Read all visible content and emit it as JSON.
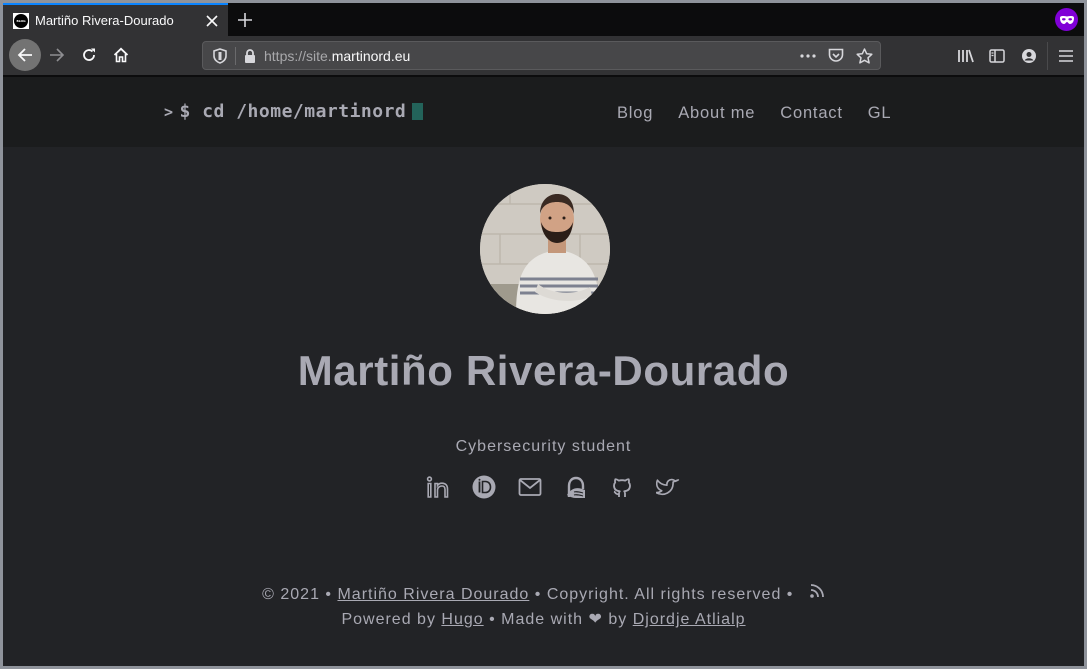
{
  "browser": {
    "tab": {
      "title": "Martiño Rivera-Dourado",
      "favicon_label": "BLOG"
    },
    "url": {
      "scheme_prefix": "https://site.",
      "host": "martinord.eu"
    },
    "icons": {
      "back": "arrow-left-icon",
      "forward": "arrow-right-icon",
      "reload": "reload-icon",
      "home": "home-icon",
      "shield": "tracking-shield-icon",
      "lock": "lock-icon",
      "more": "ellipsis-icon",
      "pocket": "pocket-icon",
      "bookmark": "star-icon",
      "library": "library-icon",
      "sidebar": "sidebar-icon",
      "account": "account-icon",
      "menu": "hamburger-icon",
      "private": "private-browsing-mask-icon"
    },
    "accent_color": "#0a84ff",
    "private_color": "#8000d7"
  },
  "site": {
    "logo": {
      "prompt": ">",
      "text": "$ cd /home/martinord",
      "cursor_color": "#23635a"
    },
    "nav": [
      {
        "label": "Blog"
      },
      {
        "label": "About me"
      },
      {
        "label": "Contact"
      },
      {
        "label": "GL"
      }
    ],
    "profile": {
      "name": "Martiño Rivera-Dourado",
      "subtitle": "Cybersecurity student",
      "avatar_alt": "Portrait photo"
    },
    "socials": [
      {
        "name": "LinkedIn",
        "icon": "linkedin-icon"
      },
      {
        "name": "ORCID",
        "icon": "orcid-icon"
      },
      {
        "name": "Email",
        "icon": "mail-icon"
      },
      {
        "name": "Keybase",
        "icon": "keybase-icon"
      },
      {
        "name": "GitHub",
        "icon": "github-icon"
      },
      {
        "name": "Twitter",
        "icon": "twitter-icon"
      }
    ],
    "footer": {
      "copyright_prefix": "© 2021 • ",
      "author_link": "Martiño Rivera Dourado",
      "copyright_suffix": " • Copyright. All rights reserved • ",
      "powered_prefix": "Powered by ",
      "powered_link": "Hugo",
      "made_with": " •  Made with ❤ by ",
      "theme_author_link": "Djordje Atlialp",
      "rss_icon": "rss-icon"
    },
    "colors": {
      "background": "#222326",
      "header": "#1b1c1d",
      "text": "#a9a9b3"
    }
  }
}
